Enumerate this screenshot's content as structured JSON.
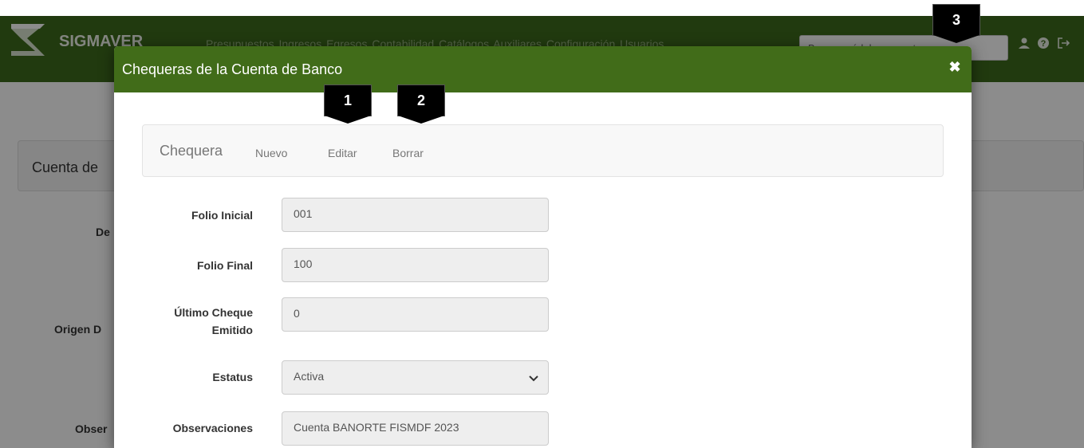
{
  "app": {
    "brand": "SIGMAVER",
    "menu_items": [
      "Presupuestos",
      "Ingresos",
      "Egresos",
      "Contabilidad",
      "Catálogos",
      "Auxiliares",
      "Configuración",
      "Usuarios"
    ],
    "search_placeholder": "Buscar módulo o reporte",
    "icons": [
      "user-icon",
      "help-icon",
      "logout-icon"
    ]
  },
  "background": {
    "panel_title": "Cuenta de",
    "labels": [
      "De",
      "Origen D",
      "Obser"
    ]
  },
  "modal": {
    "title": "Chequeras de la Cuenta de Banco",
    "close_icon": "close-icon",
    "subnav": {
      "brand": "Chequera",
      "nuevo": "Nuevo",
      "editar": "Editar",
      "borrar": "Borrar"
    },
    "form": {
      "folio_inicial_label": "Folio Inicial",
      "folio_inicial_value": "001",
      "folio_final_label": "Folio Final",
      "folio_final_value": "100",
      "ultimo_cheque_label_1": "Último Cheque",
      "ultimo_cheque_label_2": "Emitido",
      "ultimo_cheque_value": "0",
      "estatus_label": "Estatus",
      "estatus_value": "Activa",
      "observaciones_label": "Observaciones",
      "observaciones_value": "Cuenta BANORTE FISMDF 2023"
    }
  },
  "callouts": [
    "1",
    "2",
    "3"
  ],
  "colors": {
    "navbar": "#3d6a1c",
    "modal_header": "#416c19",
    "callout": "#000000"
  }
}
